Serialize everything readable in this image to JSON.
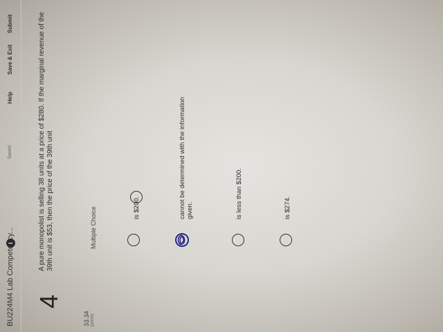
{
  "header": {
    "course_title": "BU224M4 Lab Competency...",
    "badge_count": "i",
    "saved_label": "Saved",
    "help_label": "Help",
    "save_exit_label": "Save & Exit",
    "submit_label": "Submit"
  },
  "question": {
    "number": "4",
    "points_value": "33.34",
    "points_label": "points",
    "text": "A pure monopolist is selling 38 units at a price of $280. If the marginal revenue of the 39th unit is $53, then the price of the 39th unit",
    "type": "Multiple Choice",
    "choices": [
      {
        "label": "is $200.",
        "selected": false
      },
      {
        "label": "cannot be determined with the information given.",
        "selected": true
      },
      {
        "label": "is less than $200.",
        "selected": false
      },
      {
        "label": "is $274.",
        "selected": false
      }
    ]
  },
  "colors": {
    "scribble": "#2a2a8a",
    "text": "#2b2b2b"
  }
}
